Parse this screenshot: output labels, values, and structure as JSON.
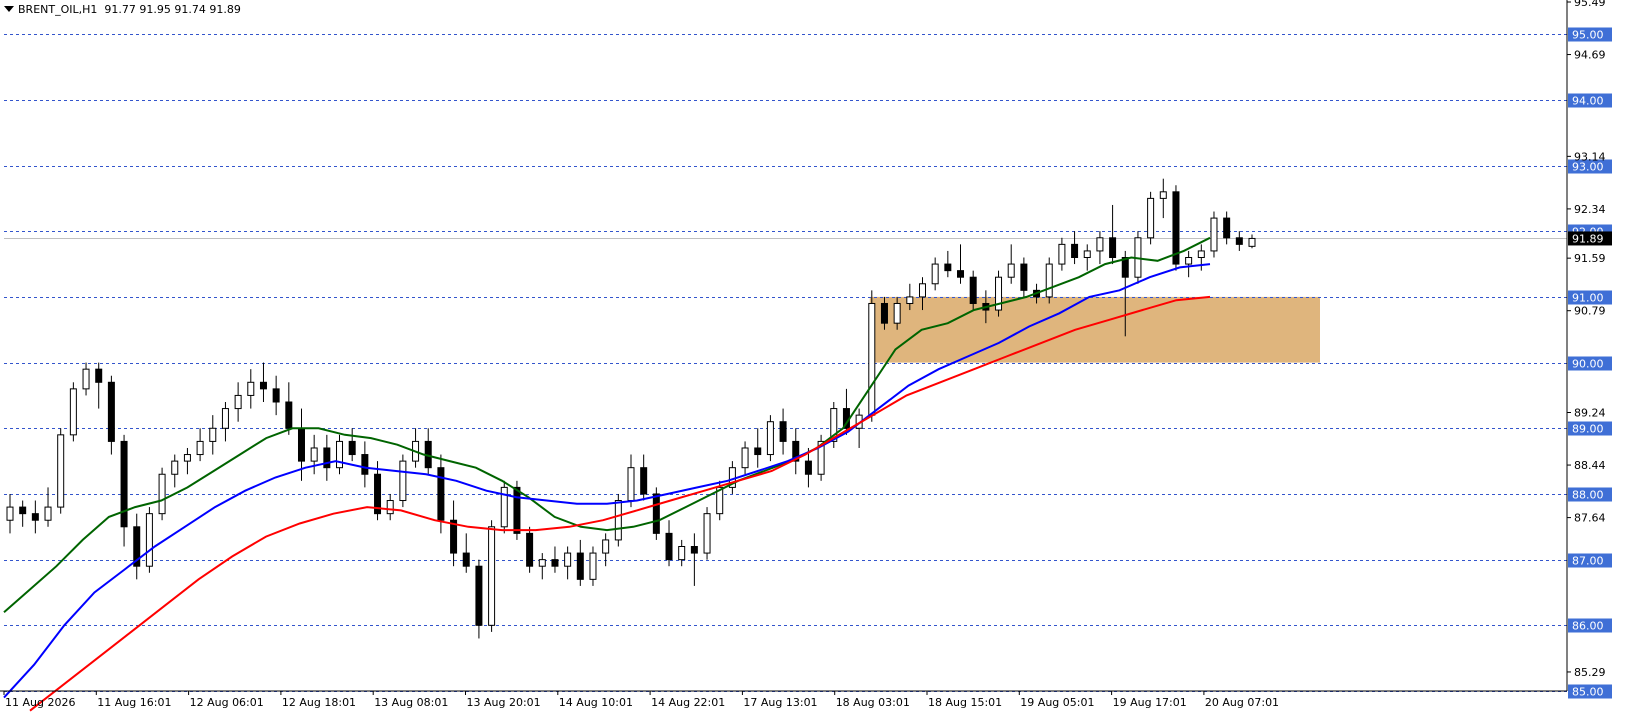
{
  "header": {
    "symbol": "BRENT_OIL,H1",
    "ohlc": "91.77 91.95 91.74 91.89"
  },
  "colors": {
    "background": "#ffffff",
    "grid_line": "#3355cc",
    "level_label_bg": "#3f6fd6",
    "ema_fast": "#006400",
    "ema_mid": "#0000ff",
    "ema_slow": "#ff0000",
    "zone_fill": "#d9a866",
    "current_price_bg": "#000000",
    "candle_bull_fill": "#ffffff",
    "candle_bear_fill": "#000000"
  },
  "chart_data": {
    "type": "candlestick",
    "symbol": "BRENT_OIL",
    "timeframe": "H1",
    "ylim": [
      85.0,
      95.49
    ],
    "price_axis_ticks": [
      "95.49",
      "94.69",
      "93.14",
      "92.34",
      "91.59",
      "90.79",
      "89.24",
      "88.44",
      "87.64",
      "85.29"
    ],
    "horizontal_levels": [
      "95.00",
      "94.00",
      "93.00",
      "92.00",
      "91.00",
      "90.00",
      "89.00",
      "88.00",
      "87.00",
      "86.00",
      "85.00"
    ],
    "current_price": "91.89",
    "time_labels": [
      "11 Aug 2026",
      "11 Aug 16:01",
      "12 Aug 06:01",
      "12 Aug 18:01",
      "13 Aug 08:01",
      "13 Aug 20:01",
      "14 Aug 10:01",
      "14 Aug 22:01",
      "17 Aug 13:01",
      "18 Aug 03:01",
      "18 Aug 15:01",
      "19 Aug 05:01",
      "19 Aug 17:01",
      "20 Aug 07:01"
    ],
    "zone": {
      "from_price": 90.0,
      "to_price": 91.0
    },
    "moving_averages": [
      {
        "color": "green",
        "values": [
          86.2,
          86.55,
          86.9,
          87.3,
          87.65,
          87.8,
          87.9,
          88.1,
          88.35,
          88.6,
          88.85,
          89.0,
          89.0,
          88.9,
          88.85,
          88.75,
          88.6,
          88.5,
          88.4,
          88.2,
          87.95,
          87.65,
          87.5,
          87.45,
          87.5,
          87.6,
          87.8,
          88.0,
          88.2,
          88.35,
          88.5,
          88.7,
          89.0,
          89.6,
          90.2,
          90.5,
          90.6,
          90.8,
          90.9,
          91.0,
          91.15,
          91.3,
          91.5,
          91.6,
          91.55,
          91.7,
          91.9
        ]
      },
      {
        "color": "blue",
        "values": [
          84.9,
          85.4,
          86.0,
          86.5,
          86.85,
          87.2,
          87.5,
          87.8,
          88.05,
          88.25,
          88.4,
          88.5,
          88.4,
          88.35,
          88.3,
          88.2,
          88.05,
          87.95,
          87.9,
          87.85,
          87.85,
          87.9,
          88.0,
          88.1,
          88.2,
          88.35,
          88.5,
          88.7,
          88.95,
          89.3,
          89.65,
          89.9,
          90.1,
          90.3,
          90.55,
          90.75,
          91.0,
          91.1,
          91.3,
          91.45,
          91.5
        ]
      },
      {
        "color": "red",
        "values": [
          84.7,
          85.1,
          85.5,
          85.9,
          86.3,
          86.7,
          87.05,
          87.35,
          87.55,
          87.7,
          87.8,
          87.75,
          87.6,
          87.5,
          87.45,
          87.45,
          87.5,
          87.6,
          87.75,
          87.9,
          88.05,
          88.2,
          88.35,
          88.6,
          88.9,
          89.2,
          89.5,
          89.7,
          89.9,
          90.1,
          90.3,
          90.5,
          90.65,
          90.8,
          90.95,
          91.0
        ]
      }
    ],
    "candles": [
      {
        "o": 87.6,
        "h": 88.0,
        "l": 87.4,
        "c": 87.8
      },
      {
        "o": 87.8,
        "h": 87.9,
        "l": 87.5,
        "c": 87.7
      },
      {
        "o": 87.7,
        "h": 87.9,
        "l": 87.4,
        "c": 87.6
      },
      {
        "o": 87.6,
        "h": 88.1,
        "l": 87.5,
        "c": 87.8
      },
      {
        "o": 87.8,
        "h": 89.0,
        "l": 87.7,
        "c": 88.9
      },
      {
        "o": 88.9,
        "h": 89.7,
        "l": 88.8,
        "c": 89.6
      },
      {
        "o": 89.6,
        "h": 90.0,
        "l": 89.5,
        "c": 89.9
      },
      {
        "o": 89.9,
        "h": 90.0,
        "l": 89.3,
        "c": 89.7
      },
      {
        "o": 89.7,
        "h": 89.8,
        "l": 88.6,
        "c": 88.8
      },
      {
        "o": 88.8,
        "h": 88.9,
        "l": 87.2,
        "c": 87.5
      },
      {
        "o": 87.5,
        "h": 87.7,
        "l": 86.7,
        "c": 86.9
      },
      {
        "o": 86.9,
        "h": 87.8,
        "l": 86.8,
        "c": 87.7
      },
      {
        "o": 87.7,
        "h": 88.4,
        "l": 87.6,
        "c": 88.3
      },
      {
        "o": 88.3,
        "h": 88.6,
        "l": 88.1,
        "c": 88.5
      },
      {
        "o": 88.5,
        "h": 88.7,
        "l": 88.3,
        "c": 88.6
      },
      {
        "o": 88.6,
        "h": 89.0,
        "l": 88.5,
        "c": 88.8
      },
      {
        "o": 88.8,
        "h": 89.2,
        "l": 88.6,
        "c": 89.0
      },
      {
        "o": 89.0,
        "h": 89.4,
        "l": 88.8,
        "c": 89.3
      },
      {
        "o": 89.3,
        "h": 89.7,
        "l": 89.1,
        "c": 89.5
      },
      {
        "o": 89.5,
        "h": 89.9,
        "l": 89.3,
        "c": 89.7
      },
      {
        "o": 89.7,
        "h": 90.0,
        "l": 89.4,
        "c": 89.6
      },
      {
        "o": 89.6,
        "h": 89.8,
        "l": 89.2,
        "c": 89.4
      },
      {
        "o": 89.4,
        "h": 89.7,
        "l": 88.9,
        "c": 89.0
      },
      {
        "o": 89.0,
        "h": 89.3,
        "l": 88.2,
        "c": 88.5
      },
      {
        "o": 88.5,
        "h": 88.9,
        "l": 88.3,
        "c": 88.7
      },
      {
        "o": 88.7,
        "h": 88.9,
        "l": 88.2,
        "c": 88.4
      },
      {
        "o": 88.4,
        "h": 88.9,
        "l": 88.3,
        "c": 88.8
      },
      {
        "o": 88.8,
        "h": 89.0,
        "l": 88.5,
        "c": 88.6
      },
      {
        "o": 88.6,
        "h": 88.8,
        "l": 88.1,
        "c": 88.3
      },
      {
        "o": 88.3,
        "h": 88.5,
        "l": 87.6,
        "c": 87.7
      },
      {
        "o": 87.7,
        "h": 88.0,
        "l": 87.6,
        "c": 87.9
      },
      {
        "o": 87.9,
        "h": 88.6,
        "l": 87.8,
        "c": 88.5
      },
      {
        "o": 88.5,
        "h": 89.0,
        "l": 88.4,
        "c": 88.8
      },
      {
        "o": 88.8,
        "h": 89.0,
        "l": 88.3,
        "c": 88.4
      },
      {
        "o": 88.4,
        "h": 88.6,
        "l": 87.4,
        "c": 87.6
      },
      {
        "o": 87.6,
        "h": 87.9,
        "l": 86.9,
        "c": 87.1
      },
      {
        "o": 87.1,
        "h": 87.4,
        "l": 86.8,
        "c": 86.9
      },
      {
        "o": 86.9,
        "h": 87.0,
        "l": 85.8,
        "c": 86.0
      },
      {
        "o": 86.0,
        "h": 87.6,
        "l": 85.9,
        "c": 87.5
      },
      {
        "o": 87.5,
        "h": 88.2,
        "l": 87.4,
        "c": 88.1
      },
      {
        "o": 88.1,
        "h": 88.2,
        "l": 87.3,
        "c": 87.4
      },
      {
        "o": 87.4,
        "h": 87.5,
        "l": 86.8,
        "c": 86.9
      },
      {
        "o": 86.9,
        "h": 87.1,
        "l": 86.7,
        "c": 87.0
      },
      {
        "o": 87.0,
        "h": 87.2,
        "l": 86.8,
        "c": 86.9
      },
      {
        "o": 86.9,
        "h": 87.2,
        "l": 86.7,
        "c": 87.1
      },
      {
        "o": 87.1,
        "h": 87.3,
        "l": 86.6,
        "c": 86.7
      },
      {
        "o": 86.7,
        "h": 87.2,
        "l": 86.6,
        "c": 87.1
      },
      {
        "o": 87.1,
        "h": 87.4,
        "l": 86.9,
        "c": 87.3
      },
      {
        "o": 87.3,
        "h": 88.0,
        "l": 87.2,
        "c": 87.9
      },
      {
        "o": 87.9,
        "h": 88.6,
        "l": 87.8,
        "c": 88.4
      },
      {
        "o": 88.4,
        "h": 88.6,
        "l": 87.9,
        "c": 88.0
      },
      {
        "o": 88.0,
        "h": 88.1,
        "l": 87.3,
        "c": 87.4
      },
      {
        "o": 87.4,
        "h": 87.6,
        "l": 86.9,
        "c": 87.0
      },
      {
        "o": 87.0,
        "h": 87.3,
        "l": 86.9,
        "c": 87.2
      },
      {
        "o": 87.2,
        "h": 87.4,
        "l": 86.6,
        "c": 87.1
      },
      {
        "o": 87.1,
        "h": 87.8,
        "l": 87.0,
        "c": 87.7
      },
      {
        "o": 87.7,
        "h": 88.2,
        "l": 87.6,
        "c": 88.1
      },
      {
        "o": 88.1,
        "h": 88.5,
        "l": 88.0,
        "c": 88.4
      },
      {
        "o": 88.4,
        "h": 88.8,
        "l": 88.3,
        "c": 88.7
      },
      {
        "o": 88.7,
        "h": 89.0,
        "l": 88.4,
        "c": 88.6
      },
      {
        "o": 88.6,
        "h": 89.2,
        "l": 88.5,
        "c": 89.1
      },
      {
        "o": 89.1,
        "h": 89.3,
        "l": 88.6,
        "c": 88.8
      },
      {
        "o": 88.8,
        "h": 89.0,
        "l": 88.3,
        "c": 88.5
      },
      {
        "o": 88.5,
        "h": 88.7,
        "l": 88.1,
        "c": 88.3
      },
      {
        "o": 88.3,
        "h": 88.9,
        "l": 88.2,
        "c": 88.8
      },
      {
        "o": 88.8,
        "h": 89.4,
        "l": 88.7,
        "c": 89.3
      },
      {
        "o": 89.3,
        "h": 89.6,
        "l": 88.9,
        "c": 89.0
      },
      {
        "o": 89.0,
        "h": 89.3,
        "l": 88.7,
        "c": 89.2
      },
      {
        "o": 89.2,
        "h": 91.1,
        "l": 89.1,
        "c": 90.9
      },
      {
        "o": 90.9,
        "h": 91.0,
        "l": 90.5,
        "c": 90.6
      },
      {
        "o": 90.6,
        "h": 91.0,
        "l": 90.5,
        "c": 90.9
      },
      {
        "o": 90.9,
        "h": 91.2,
        "l": 90.8,
        "c": 91.0
      },
      {
        "o": 91.0,
        "h": 91.3,
        "l": 90.8,
        "c": 91.2
      },
      {
        "o": 91.2,
        "h": 91.6,
        "l": 91.1,
        "c": 91.5
      },
      {
        "o": 91.5,
        "h": 91.7,
        "l": 91.3,
        "c": 91.4
      },
      {
        "o": 91.4,
        "h": 91.8,
        "l": 91.2,
        "c": 91.3
      },
      {
        "o": 91.3,
        "h": 91.4,
        "l": 90.8,
        "c": 90.9
      },
      {
        "o": 90.9,
        "h": 91.1,
        "l": 90.6,
        "c": 90.8
      },
      {
        "o": 90.8,
        "h": 91.4,
        "l": 90.7,
        "c": 91.3
      },
      {
        "o": 91.3,
        "h": 91.8,
        "l": 91.2,
        "c": 91.5
      },
      {
        "o": 91.5,
        "h": 91.6,
        "l": 91.0,
        "c": 91.1
      },
      {
        "o": 91.1,
        "h": 91.2,
        "l": 90.9,
        "c": 91.0
      },
      {
        "o": 91.0,
        "h": 91.6,
        "l": 90.9,
        "c": 91.5
      },
      {
        "o": 91.5,
        "h": 91.9,
        "l": 91.4,
        "c": 91.8
      },
      {
        "o": 91.8,
        "h": 92.0,
        "l": 91.5,
        "c": 91.6
      },
      {
        "o": 91.6,
        "h": 91.8,
        "l": 91.4,
        "c": 91.7
      },
      {
        "o": 91.7,
        "h": 92.0,
        "l": 91.5,
        "c": 91.9
      },
      {
        "o": 91.9,
        "h": 92.4,
        "l": 91.5,
        "c": 91.6
      },
      {
        "o": 91.6,
        "h": 91.7,
        "l": 90.4,
        "c": 91.3
      },
      {
        "o": 91.3,
        "h": 92.0,
        "l": 91.2,
        "c": 91.9
      },
      {
        "o": 91.9,
        "h": 92.6,
        "l": 91.8,
        "c": 92.5
      },
      {
        "o": 92.5,
        "h": 92.8,
        "l": 92.2,
        "c": 92.6
      },
      {
        "o": 92.6,
        "h": 92.7,
        "l": 91.4,
        "c": 91.5
      },
      {
        "o": 91.5,
        "h": 91.7,
        "l": 91.3,
        "c": 91.6
      },
      {
        "o": 91.6,
        "h": 91.8,
        "l": 91.4,
        "c": 91.7
      },
      {
        "o": 91.7,
        "h": 92.3,
        "l": 91.6,
        "c": 92.2
      },
      {
        "o": 92.2,
        "h": 92.3,
        "l": 91.8,
        "c": 91.9
      },
      {
        "o": 91.9,
        "h": 92.0,
        "l": 91.7,
        "c": 91.8
      },
      {
        "o": 91.77,
        "h": 91.95,
        "l": 91.74,
        "c": 91.89
      }
    ]
  }
}
